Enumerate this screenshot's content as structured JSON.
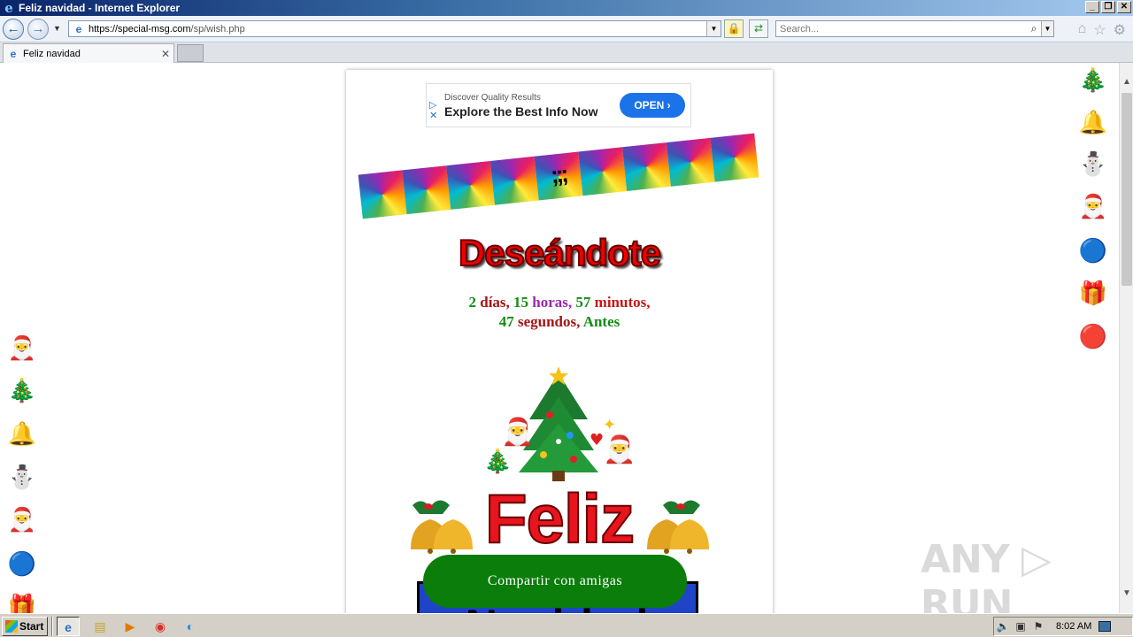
{
  "window": {
    "title": "Feliz navidad - Internet Explorer"
  },
  "nav": {
    "url_host": "https://special-msg.com",
    "url_path": "/sp/wish.php",
    "search_placeholder": "Search..."
  },
  "tab": {
    "label": "Feliz navidad"
  },
  "ad": {
    "small_text": "Discover Quality Results",
    "big_text": "Explore the Best Info Now",
    "open_label": "OPEN",
    "open_arrow": "›"
  },
  "banner": {
    "symbol": ";;;"
  },
  "page": {
    "heading": "Deseándote",
    "countdown": {
      "days_num": "2",
      "days_word": "días,",
      "hours_num": "15",
      "hours_word": "horas,",
      "minutes_num": "57",
      "minutes_word": "minutos,",
      "seconds_num": "47",
      "seconds_word": "segundos,",
      "before_word": "Antes"
    },
    "feliz": "Feliz",
    "navidad": "Navidad",
    "share_button": "Compartir con amigas"
  },
  "watermark": "ANY ▷ RUN",
  "taskbar": {
    "start_label": "Start",
    "clock": "8:02 AM"
  },
  "colors": {
    "heading_red": "#e00000",
    "green": "#128c12",
    "purple": "#9c27b0",
    "share_green": "#0a7d0a",
    "ad_blue": "#1a73e8"
  }
}
